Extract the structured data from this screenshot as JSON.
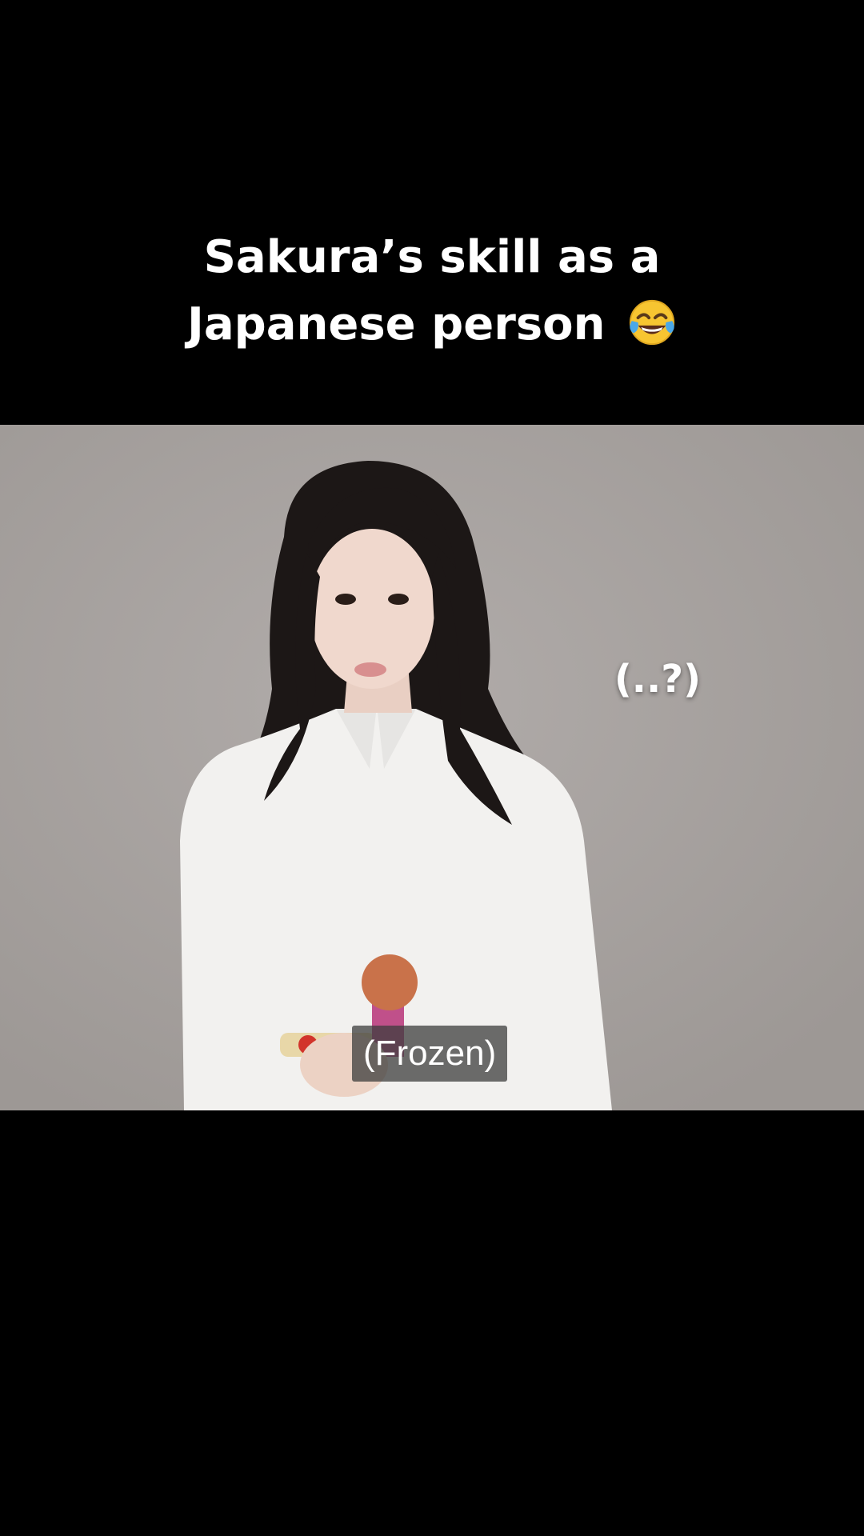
{
  "caption": {
    "line1": "Sakura’s skill as a",
    "line2": "Japanese person",
    "emoji": "face-with-tears-of-joy-icon"
  },
  "video": {
    "overlay_text": "(..?)",
    "subtitle": "(Frozen)"
  },
  "colors": {
    "background": "#000000",
    "caption_text": "#ffffff",
    "video_backdrop": "#a6a19e",
    "subtitle_box": "#3c3c3c"
  }
}
